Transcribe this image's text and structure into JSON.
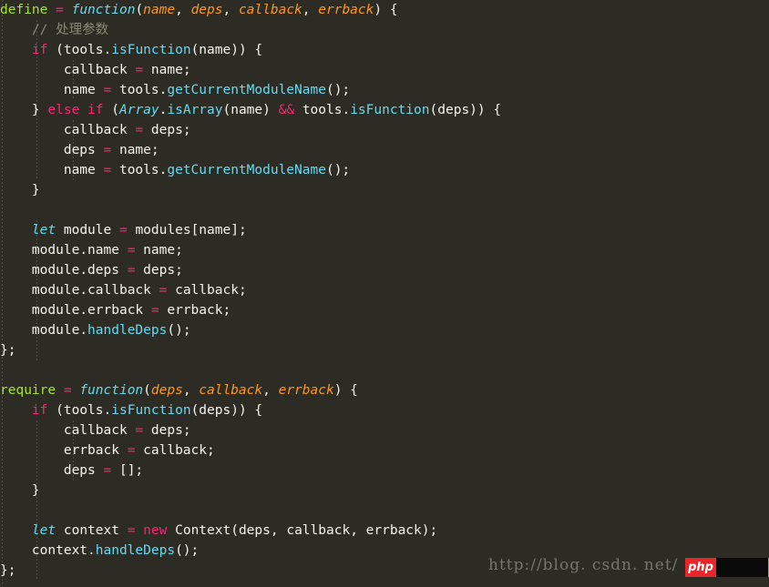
{
  "editor": {
    "theme": "monokai",
    "language": "javascript",
    "background_color": "#2c2c25",
    "font_size_px": 14.5,
    "line_height_px": 22,
    "indent_guide_color": "#4e4e45"
  },
  "colors": {
    "plain": "#f5f5ec",
    "keyword": "#f92672",
    "operator": "#f92672",
    "function_name": "#a6e22e",
    "type_builtin": "#66d9ef",
    "method": "#66d9ef",
    "parameter": "#fd971f",
    "comment": "#8a8a72",
    "watermark_text": "#75756c",
    "badge_red": "#e8262a"
  },
  "code": {
    "lines": [
      {
        "n": 1,
        "indent": 0,
        "tokens": [
          {
            "t": "define",
            "c": "t-green"
          },
          {
            "t": " ",
            "c": "t-plain"
          },
          {
            "t": "=",
            "c": "t-pink"
          },
          {
            "t": " ",
            "c": "t-plain"
          },
          {
            "t": "function",
            "c": "t-cyan-i"
          },
          {
            "t": "(",
            "c": "t-punc"
          },
          {
            "t": "name",
            "c": "t-orange-i"
          },
          {
            "t": ", ",
            "c": "t-punc"
          },
          {
            "t": "deps",
            "c": "t-orange-i"
          },
          {
            "t": ", ",
            "c": "t-punc"
          },
          {
            "t": "callback",
            "c": "t-orange-i"
          },
          {
            "t": ", ",
            "c": "t-punc"
          },
          {
            "t": "errback",
            "c": "t-orange-i"
          },
          {
            "t": ") {",
            "c": "t-punc"
          }
        ]
      },
      {
        "n": 2,
        "indent": 1,
        "tokens": [
          {
            "t": "// 处理参数",
            "c": "t-comment"
          }
        ]
      },
      {
        "n": 3,
        "indent": 1,
        "tokens": [
          {
            "t": "if",
            "c": "t-pink"
          },
          {
            "t": " (",
            "c": "t-punc"
          },
          {
            "t": "tools",
            "c": "t-plain"
          },
          {
            "t": ".",
            "c": "t-punc"
          },
          {
            "t": "isFunction",
            "c": "t-cyan"
          },
          {
            "t": "(",
            "c": "t-punc"
          },
          {
            "t": "name",
            "c": "t-plain"
          },
          {
            "t": ")) {",
            "c": "t-punc"
          }
        ]
      },
      {
        "n": 4,
        "indent": 2,
        "tokens": [
          {
            "t": "callback",
            "c": "t-plain"
          },
          {
            "t": " ",
            "c": "t-plain"
          },
          {
            "t": "=",
            "c": "t-pink"
          },
          {
            "t": " ",
            "c": "t-plain"
          },
          {
            "t": "name",
            "c": "t-plain"
          },
          {
            "t": ";",
            "c": "t-punc"
          }
        ]
      },
      {
        "n": 5,
        "indent": 2,
        "tokens": [
          {
            "t": "name",
            "c": "t-plain"
          },
          {
            "t": " ",
            "c": "t-plain"
          },
          {
            "t": "=",
            "c": "t-pink"
          },
          {
            "t": " ",
            "c": "t-plain"
          },
          {
            "t": "tools",
            "c": "t-plain"
          },
          {
            "t": ".",
            "c": "t-punc"
          },
          {
            "t": "getCurrentModuleName",
            "c": "t-cyan"
          },
          {
            "t": "();",
            "c": "t-punc"
          }
        ]
      },
      {
        "n": 6,
        "indent": 1,
        "tokens": [
          {
            "t": "} ",
            "c": "t-punc"
          },
          {
            "t": "else",
            "c": "t-pink"
          },
          {
            "t": " ",
            "c": "t-plain"
          },
          {
            "t": "if",
            "c": "t-pink"
          },
          {
            "t": " (",
            "c": "t-punc"
          },
          {
            "t": "Array",
            "c": "t-cyan-i"
          },
          {
            "t": ".",
            "c": "t-punc"
          },
          {
            "t": "isArray",
            "c": "t-cyan"
          },
          {
            "t": "(",
            "c": "t-punc"
          },
          {
            "t": "name",
            "c": "t-plain"
          },
          {
            "t": ") ",
            "c": "t-punc"
          },
          {
            "t": "&&",
            "c": "t-pink"
          },
          {
            "t": " ",
            "c": "t-plain"
          },
          {
            "t": "tools",
            "c": "t-plain"
          },
          {
            "t": ".",
            "c": "t-punc"
          },
          {
            "t": "isFunction",
            "c": "t-cyan"
          },
          {
            "t": "(",
            "c": "t-punc"
          },
          {
            "t": "deps",
            "c": "t-plain"
          },
          {
            "t": ")) {",
            "c": "t-punc"
          }
        ]
      },
      {
        "n": 7,
        "indent": 2,
        "tokens": [
          {
            "t": "callback",
            "c": "t-plain"
          },
          {
            "t": " ",
            "c": "t-plain"
          },
          {
            "t": "=",
            "c": "t-pink"
          },
          {
            "t": " ",
            "c": "t-plain"
          },
          {
            "t": "deps",
            "c": "t-plain"
          },
          {
            "t": ";",
            "c": "t-punc"
          }
        ]
      },
      {
        "n": 8,
        "indent": 2,
        "tokens": [
          {
            "t": "deps",
            "c": "t-plain"
          },
          {
            "t": " ",
            "c": "t-plain"
          },
          {
            "t": "=",
            "c": "t-pink"
          },
          {
            "t": " ",
            "c": "t-plain"
          },
          {
            "t": "name",
            "c": "t-plain"
          },
          {
            "t": ";",
            "c": "t-punc"
          }
        ]
      },
      {
        "n": 9,
        "indent": 2,
        "tokens": [
          {
            "t": "name",
            "c": "t-plain"
          },
          {
            "t": " ",
            "c": "t-plain"
          },
          {
            "t": "=",
            "c": "t-pink"
          },
          {
            "t": " ",
            "c": "t-plain"
          },
          {
            "t": "tools",
            "c": "t-plain"
          },
          {
            "t": ".",
            "c": "t-punc"
          },
          {
            "t": "getCurrentModuleName",
            "c": "t-cyan"
          },
          {
            "t": "();",
            "c": "t-punc"
          }
        ]
      },
      {
        "n": 10,
        "indent": 1,
        "tokens": [
          {
            "t": "}",
            "c": "t-punc"
          }
        ]
      },
      {
        "n": 11,
        "indent": 0,
        "tokens": []
      },
      {
        "n": 12,
        "indent": 1,
        "tokens": [
          {
            "t": "let",
            "c": "t-cyan-i"
          },
          {
            "t": " ",
            "c": "t-plain"
          },
          {
            "t": "module",
            "c": "t-plain"
          },
          {
            "t": " ",
            "c": "t-plain"
          },
          {
            "t": "=",
            "c": "t-pink"
          },
          {
            "t": " ",
            "c": "t-plain"
          },
          {
            "t": "modules",
            "c": "t-plain"
          },
          {
            "t": "[",
            "c": "t-punc"
          },
          {
            "t": "name",
            "c": "t-plain"
          },
          {
            "t": "];",
            "c": "t-punc"
          }
        ]
      },
      {
        "n": 13,
        "indent": 1,
        "tokens": [
          {
            "t": "module",
            "c": "t-plain"
          },
          {
            "t": ".",
            "c": "t-punc"
          },
          {
            "t": "name",
            "c": "t-plain"
          },
          {
            "t": " ",
            "c": "t-plain"
          },
          {
            "t": "=",
            "c": "t-pink"
          },
          {
            "t": " ",
            "c": "t-plain"
          },
          {
            "t": "name",
            "c": "t-plain"
          },
          {
            "t": ";",
            "c": "t-punc"
          }
        ]
      },
      {
        "n": 14,
        "indent": 1,
        "tokens": [
          {
            "t": "module",
            "c": "t-plain"
          },
          {
            "t": ".",
            "c": "t-punc"
          },
          {
            "t": "deps",
            "c": "t-plain"
          },
          {
            "t": " ",
            "c": "t-plain"
          },
          {
            "t": "=",
            "c": "t-pink"
          },
          {
            "t": " ",
            "c": "t-plain"
          },
          {
            "t": "deps",
            "c": "t-plain"
          },
          {
            "t": ";",
            "c": "t-punc"
          }
        ]
      },
      {
        "n": 15,
        "indent": 1,
        "tokens": [
          {
            "t": "module",
            "c": "t-plain"
          },
          {
            "t": ".",
            "c": "t-punc"
          },
          {
            "t": "callback",
            "c": "t-plain"
          },
          {
            "t": " ",
            "c": "t-plain"
          },
          {
            "t": "=",
            "c": "t-pink"
          },
          {
            "t": " ",
            "c": "t-plain"
          },
          {
            "t": "callback",
            "c": "t-plain"
          },
          {
            "t": ";",
            "c": "t-punc"
          }
        ]
      },
      {
        "n": 16,
        "indent": 1,
        "tokens": [
          {
            "t": "module",
            "c": "t-plain"
          },
          {
            "t": ".",
            "c": "t-punc"
          },
          {
            "t": "errback",
            "c": "t-plain"
          },
          {
            "t": " ",
            "c": "t-plain"
          },
          {
            "t": "=",
            "c": "t-pink"
          },
          {
            "t": " ",
            "c": "t-plain"
          },
          {
            "t": "errback",
            "c": "t-plain"
          },
          {
            "t": ";",
            "c": "t-punc"
          }
        ]
      },
      {
        "n": 17,
        "indent": 1,
        "tokens": [
          {
            "t": "module",
            "c": "t-plain"
          },
          {
            "t": ".",
            "c": "t-punc"
          },
          {
            "t": "handleDeps",
            "c": "t-cyan"
          },
          {
            "t": "();",
            "c": "t-punc"
          }
        ]
      },
      {
        "n": 18,
        "indent": 0,
        "tokens": [
          {
            "t": "};",
            "c": "t-punc"
          }
        ]
      },
      {
        "n": 19,
        "indent": 0,
        "tokens": []
      },
      {
        "n": 20,
        "indent": 0,
        "tokens": [
          {
            "t": "require",
            "c": "t-green"
          },
          {
            "t": " ",
            "c": "t-plain"
          },
          {
            "t": "=",
            "c": "t-pink"
          },
          {
            "t": " ",
            "c": "t-plain"
          },
          {
            "t": "function",
            "c": "t-cyan-i"
          },
          {
            "t": "(",
            "c": "t-punc"
          },
          {
            "t": "deps",
            "c": "t-orange-i"
          },
          {
            "t": ", ",
            "c": "t-punc"
          },
          {
            "t": "callback",
            "c": "t-orange-i"
          },
          {
            "t": ", ",
            "c": "t-punc"
          },
          {
            "t": "errback",
            "c": "t-orange-i"
          },
          {
            "t": ") {",
            "c": "t-punc"
          }
        ]
      },
      {
        "n": 21,
        "indent": 1,
        "tokens": [
          {
            "t": "if",
            "c": "t-pink"
          },
          {
            "t": " (",
            "c": "t-punc"
          },
          {
            "t": "tools",
            "c": "t-plain"
          },
          {
            "t": ".",
            "c": "t-punc"
          },
          {
            "t": "isFunction",
            "c": "t-cyan"
          },
          {
            "t": "(",
            "c": "t-punc"
          },
          {
            "t": "deps",
            "c": "t-plain"
          },
          {
            "t": ")) {",
            "c": "t-punc"
          }
        ]
      },
      {
        "n": 22,
        "indent": 2,
        "tokens": [
          {
            "t": "callback",
            "c": "t-plain"
          },
          {
            "t": " ",
            "c": "t-plain"
          },
          {
            "t": "=",
            "c": "t-pink"
          },
          {
            "t": " ",
            "c": "t-plain"
          },
          {
            "t": "deps",
            "c": "t-plain"
          },
          {
            "t": ";",
            "c": "t-punc"
          }
        ]
      },
      {
        "n": 23,
        "indent": 2,
        "tokens": [
          {
            "t": "errback",
            "c": "t-plain"
          },
          {
            "t": " ",
            "c": "t-plain"
          },
          {
            "t": "=",
            "c": "t-pink"
          },
          {
            "t": " ",
            "c": "t-plain"
          },
          {
            "t": "callback",
            "c": "t-plain"
          },
          {
            "t": ";",
            "c": "t-punc"
          }
        ]
      },
      {
        "n": 24,
        "indent": 2,
        "tokens": [
          {
            "t": "deps",
            "c": "t-plain"
          },
          {
            "t": " ",
            "c": "t-plain"
          },
          {
            "t": "=",
            "c": "t-pink"
          },
          {
            "t": " ",
            "c": "t-plain"
          },
          {
            "t": "[];",
            "c": "t-punc"
          }
        ]
      },
      {
        "n": 25,
        "indent": 1,
        "tokens": [
          {
            "t": "}",
            "c": "t-punc"
          }
        ]
      },
      {
        "n": 26,
        "indent": 0,
        "tokens": []
      },
      {
        "n": 27,
        "indent": 1,
        "tokens": [
          {
            "t": "let",
            "c": "t-cyan-i"
          },
          {
            "t": " ",
            "c": "t-plain"
          },
          {
            "t": "context",
            "c": "t-plain"
          },
          {
            "t": " ",
            "c": "t-plain"
          },
          {
            "t": "=",
            "c": "t-pink"
          },
          {
            "t": " ",
            "c": "t-plain"
          },
          {
            "t": "new",
            "c": "t-pink"
          },
          {
            "t": " ",
            "c": "t-plain"
          },
          {
            "t": "Context",
            "c": "t-plain"
          },
          {
            "t": "(",
            "c": "t-punc"
          },
          {
            "t": "deps",
            "c": "t-plain"
          },
          {
            "t": ", ",
            "c": "t-punc"
          },
          {
            "t": "callback",
            "c": "t-plain"
          },
          {
            "t": ", ",
            "c": "t-punc"
          },
          {
            "t": "errback",
            "c": "t-plain"
          },
          {
            "t": ");",
            "c": "t-punc"
          }
        ]
      },
      {
        "n": 28,
        "indent": 1,
        "tokens": [
          {
            "t": "context",
            "c": "t-plain"
          },
          {
            "t": ".",
            "c": "t-punc"
          },
          {
            "t": "handleDeps",
            "c": "t-cyan"
          },
          {
            "t": "();",
            "c": "t-punc"
          }
        ]
      },
      {
        "n": 29,
        "indent": 0,
        "tokens": [
          {
            "t": "};",
            "c": "t-punc"
          }
        ]
      }
    ]
  },
  "watermark": {
    "url_text": "http://blog. csdn. net/",
    "badge_label": "php"
  }
}
